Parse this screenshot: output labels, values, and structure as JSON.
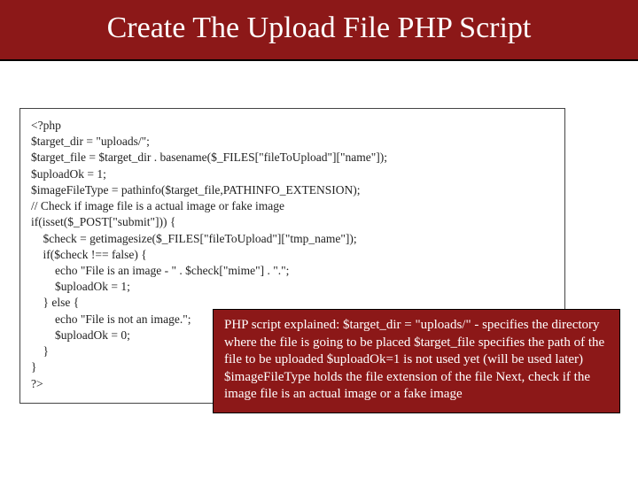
{
  "header": {
    "title": "Create The Upload File PHP Script"
  },
  "code": {
    "text": "<?php\n$target_dir = \"uploads/\";\n$target_file = $target_dir . basename($_FILES[\"fileToUpload\"][\"name\"]);\n$uploadOk = 1;\n$imageFileType = pathinfo($target_file,PATHINFO_EXTENSION);\n// Check if image file is a actual image or fake image\nif(isset($_POST[\"submit\"])) {\n    $check = getimagesize($_FILES[\"fileToUpload\"][\"tmp_name\"]);\n    if($check !== false) {\n        echo \"File is an image - \" . $check[\"mime\"] . \".\";\n        $uploadOk = 1;\n    } else {\n        echo \"File is not an image.\";\n        $uploadOk = 0;\n    }\n}\n?>"
  },
  "explain": {
    "text": "PHP script explained:\n$target_dir = \"uploads/\" - specifies the directory where the file is going to be placed\n$target_file specifies the path of the file to be uploaded\n$uploadOk=1 is not used yet (will be used later)\n$imageFileType holds the file extension of the file\nNext, check if the image file is an actual image or a fake image"
  }
}
